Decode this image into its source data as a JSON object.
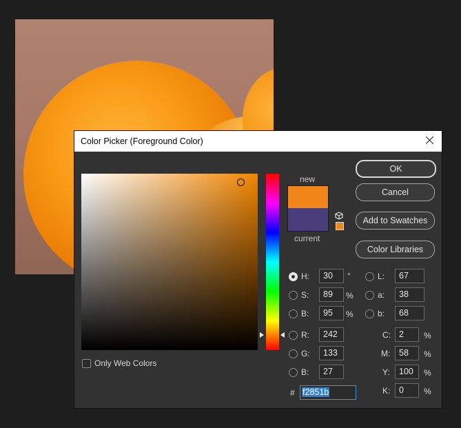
{
  "dialog": {
    "title": "Color Picker (Foreground Color)",
    "buttons": {
      "ok": "OK",
      "cancel": "Cancel",
      "add_to_swatches": "Add to Swatches",
      "color_libraries": "Color Libraries"
    },
    "preview": {
      "new_label": "new",
      "current_label": "current",
      "new_color": "#f28519",
      "current_color": "#4a3d7c"
    },
    "only_web_colors": {
      "label": "Only Web Colors",
      "checked": false
    },
    "selected_mode": "H",
    "hsb": {
      "h": {
        "label": "H:",
        "value": "30",
        "unit": "°"
      },
      "s": {
        "label": "S:",
        "value": "89",
        "unit": "%"
      },
      "b": {
        "label": "B:",
        "value": "95",
        "unit": "%"
      }
    },
    "rgb": {
      "r": {
        "label": "R:",
        "value": "242"
      },
      "g": {
        "label": "G:",
        "value": "133"
      },
      "b": {
        "label": "B:",
        "value": "27"
      }
    },
    "lab": {
      "l": {
        "label": "L:",
        "value": "67"
      },
      "a": {
        "label": "a:",
        "value": "38"
      },
      "b": {
        "label": "b:",
        "value": "68"
      }
    },
    "cmyk": {
      "c": {
        "label": "C:",
        "value": "2",
        "unit": "%"
      },
      "m": {
        "label": "M:",
        "value": "58",
        "unit": "%"
      },
      "y": {
        "label": "Y:",
        "value": "100",
        "unit": "%"
      },
      "k": {
        "label": "K:",
        "value": "0",
        "unit": "%"
      }
    },
    "hex": {
      "label": "#",
      "value": "f2851b"
    }
  }
}
